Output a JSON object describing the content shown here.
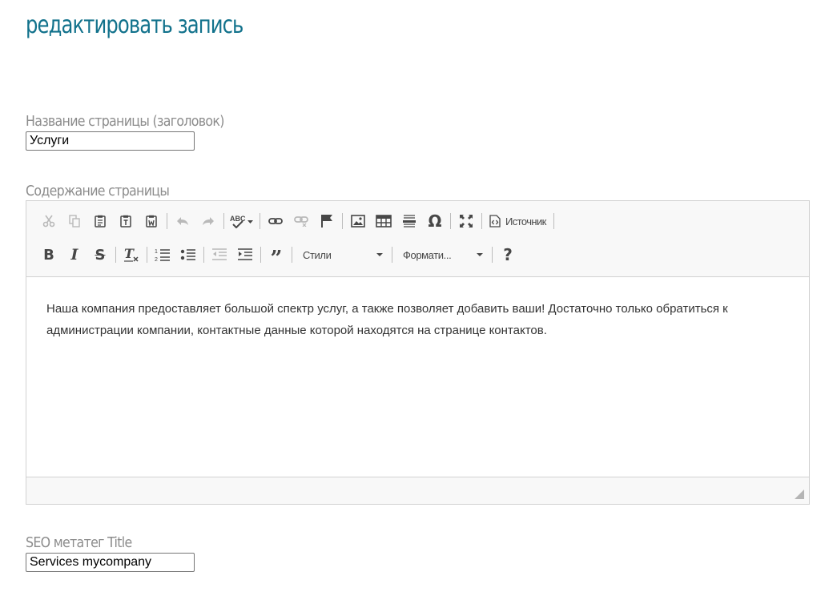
{
  "page": {
    "title": "редактировать запись"
  },
  "fields": {
    "page_name": {
      "label": "Название страницы (заголовок)",
      "value": "Услуги"
    },
    "content": {
      "label": "Содержание страницы"
    },
    "seo_title": {
      "label": "SEO метатег Title",
      "value": "Services mycompany"
    }
  },
  "editor": {
    "toolbar": {
      "row1": [
        "cut-icon",
        "copy-icon",
        "paste-icon",
        "paste-text-icon",
        "paste-word-icon",
        "undo-icon",
        "redo-icon",
        "spellcheck-icon",
        "link-icon",
        "unlink-icon",
        "anchor-flag-icon",
        "image-icon",
        "table-icon",
        "horizontal-line-icon",
        "special-char-icon",
        "maximize-icon",
        "source-icon"
      ],
      "source_label": "Источник",
      "row2": [
        "bold-icon",
        "italic-icon",
        "strikethrough-icon",
        "remove-format-icon",
        "numbered-list-icon",
        "bulleted-list-icon",
        "outdent-icon",
        "indent-icon",
        "blockquote-icon",
        "help-icon"
      ],
      "styles_combo": "Стили",
      "format_combo": "Формати..."
    },
    "content_text": "Наша компания предоставляет большой спектр услуг, а также позволяет добавить ваши! Достаточно только обратиться к администрации компании, контактные данные которой находятся на странице контактов."
  }
}
